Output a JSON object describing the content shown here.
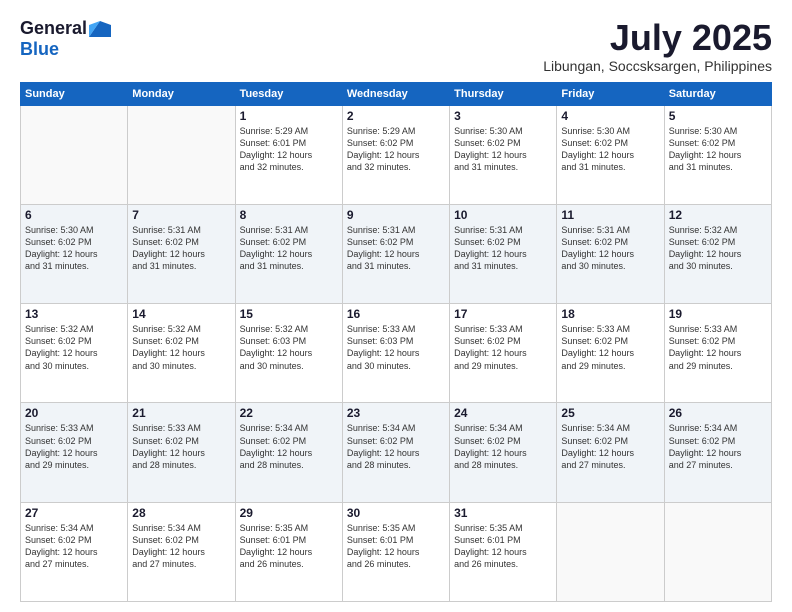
{
  "header": {
    "logo_general": "General",
    "logo_blue": "Blue",
    "month_title": "July 2025",
    "location": "Libungan, Soccsksargen, Philippines"
  },
  "weekdays": [
    "Sunday",
    "Monday",
    "Tuesday",
    "Wednesday",
    "Thursday",
    "Friday",
    "Saturday"
  ],
  "weeks": [
    [
      {
        "day": "",
        "info": ""
      },
      {
        "day": "",
        "info": ""
      },
      {
        "day": "1",
        "info": "Sunrise: 5:29 AM\nSunset: 6:01 PM\nDaylight: 12 hours\nand 32 minutes."
      },
      {
        "day": "2",
        "info": "Sunrise: 5:29 AM\nSunset: 6:02 PM\nDaylight: 12 hours\nand 32 minutes."
      },
      {
        "day": "3",
        "info": "Sunrise: 5:30 AM\nSunset: 6:02 PM\nDaylight: 12 hours\nand 31 minutes."
      },
      {
        "day": "4",
        "info": "Sunrise: 5:30 AM\nSunset: 6:02 PM\nDaylight: 12 hours\nand 31 minutes."
      },
      {
        "day": "5",
        "info": "Sunrise: 5:30 AM\nSunset: 6:02 PM\nDaylight: 12 hours\nand 31 minutes."
      }
    ],
    [
      {
        "day": "6",
        "info": "Sunrise: 5:30 AM\nSunset: 6:02 PM\nDaylight: 12 hours\nand 31 minutes."
      },
      {
        "day": "7",
        "info": "Sunrise: 5:31 AM\nSunset: 6:02 PM\nDaylight: 12 hours\nand 31 minutes."
      },
      {
        "day": "8",
        "info": "Sunrise: 5:31 AM\nSunset: 6:02 PM\nDaylight: 12 hours\nand 31 minutes."
      },
      {
        "day": "9",
        "info": "Sunrise: 5:31 AM\nSunset: 6:02 PM\nDaylight: 12 hours\nand 31 minutes."
      },
      {
        "day": "10",
        "info": "Sunrise: 5:31 AM\nSunset: 6:02 PM\nDaylight: 12 hours\nand 31 minutes."
      },
      {
        "day": "11",
        "info": "Sunrise: 5:31 AM\nSunset: 6:02 PM\nDaylight: 12 hours\nand 30 minutes."
      },
      {
        "day": "12",
        "info": "Sunrise: 5:32 AM\nSunset: 6:02 PM\nDaylight: 12 hours\nand 30 minutes."
      }
    ],
    [
      {
        "day": "13",
        "info": "Sunrise: 5:32 AM\nSunset: 6:02 PM\nDaylight: 12 hours\nand 30 minutes."
      },
      {
        "day": "14",
        "info": "Sunrise: 5:32 AM\nSunset: 6:02 PM\nDaylight: 12 hours\nand 30 minutes."
      },
      {
        "day": "15",
        "info": "Sunrise: 5:32 AM\nSunset: 6:03 PM\nDaylight: 12 hours\nand 30 minutes."
      },
      {
        "day": "16",
        "info": "Sunrise: 5:33 AM\nSunset: 6:03 PM\nDaylight: 12 hours\nand 30 minutes."
      },
      {
        "day": "17",
        "info": "Sunrise: 5:33 AM\nSunset: 6:02 PM\nDaylight: 12 hours\nand 29 minutes."
      },
      {
        "day": "18",
        "info": "Sunrise: 5:33 AM\nSunset: 6:02 PM\nDaylight: 12 hours\nand 29 minutes."
      },
      {
        "day": "19",
        "info": "Sunrise: 5:33 AM\nSunset: 6:02 PM\nDaylight: 12 hours\nand 29 minutes."
      }
    ],
    [
      {
        "day": "20",
        "info": "Sunrise: 5:33 AM\nSunset: 6:02 PM\nDaylight: 12 hours\nand 29 minutes."
      },
      {
        "day": "21",
        "info": "Sunrise: 5:33 AM\nSunset: 6:02 PM\nDaylight: 12 hours\nand 28 minutes."
      },
      {
        "day": "22",
        "info": "Sunrise: 5:34 AM\nSunset: 6:02 PM\nDaylight: 12 hours\nand 28 minutes."
      },
      {
        "day": "23",
        "info": "Sunrise: 5:34 AM\nSunset: 6:02 PM\nDaylight: 12 hours\nand 28 minutes."
      },
      {
        "day": "24",
        "info": "Sunrise: 5:34 AM\nSunset: 6:02 PM\nDaylight: 12 hours\nand 28 minutes."
      },
      {
        "day": "25",
        "info": "Sunrise: 5:34 AM\nSunset: 6:02 PM\nDaylight: 12 hours\nand 27 minutes."
      },
      {
        "day": "26",
        "info": "Sunrise: 5:34 AM\nSunset: 6:02 PM\nDaylight: 12 hours\nand 27 minutes."
      }
    ],
    [
      {
        "day": "27",
        "info": "Sunrise: 5:34 AM\nSunset: 6:02 PM\nDaylight: 12 hours\nand 27 minutes."
      },
      {
        "day": "28",
        "info": "Sunrise: 5:34 AM\nSunset: 6:02 PM\nDaylight: 12 hours\nand 27 minutes."
      },
      {
        "day": "29",
        "info": "Sunrise: 5:35 AM\nSunset: 6:01 PM\nDaylight: 12 hours\nand 26 minutes."
      },
      {
        "day": "30",
        "info": "Sunrise: 5:35 AM\nSunset: 6:01 PM\nDaylight: 12 hours\nand 26 minutes."
      },
      {
        "day": "31",
        "info": "Sunrise: 5:35 AM\nSunset: 6:01 PM\nDaylight: 12 hours\nand 26 minutes."
      },
      {
        "day": "",
        "info": ""
      },
      {
        "day": "",
        "info": ""
      }
    ]
  ]
}
